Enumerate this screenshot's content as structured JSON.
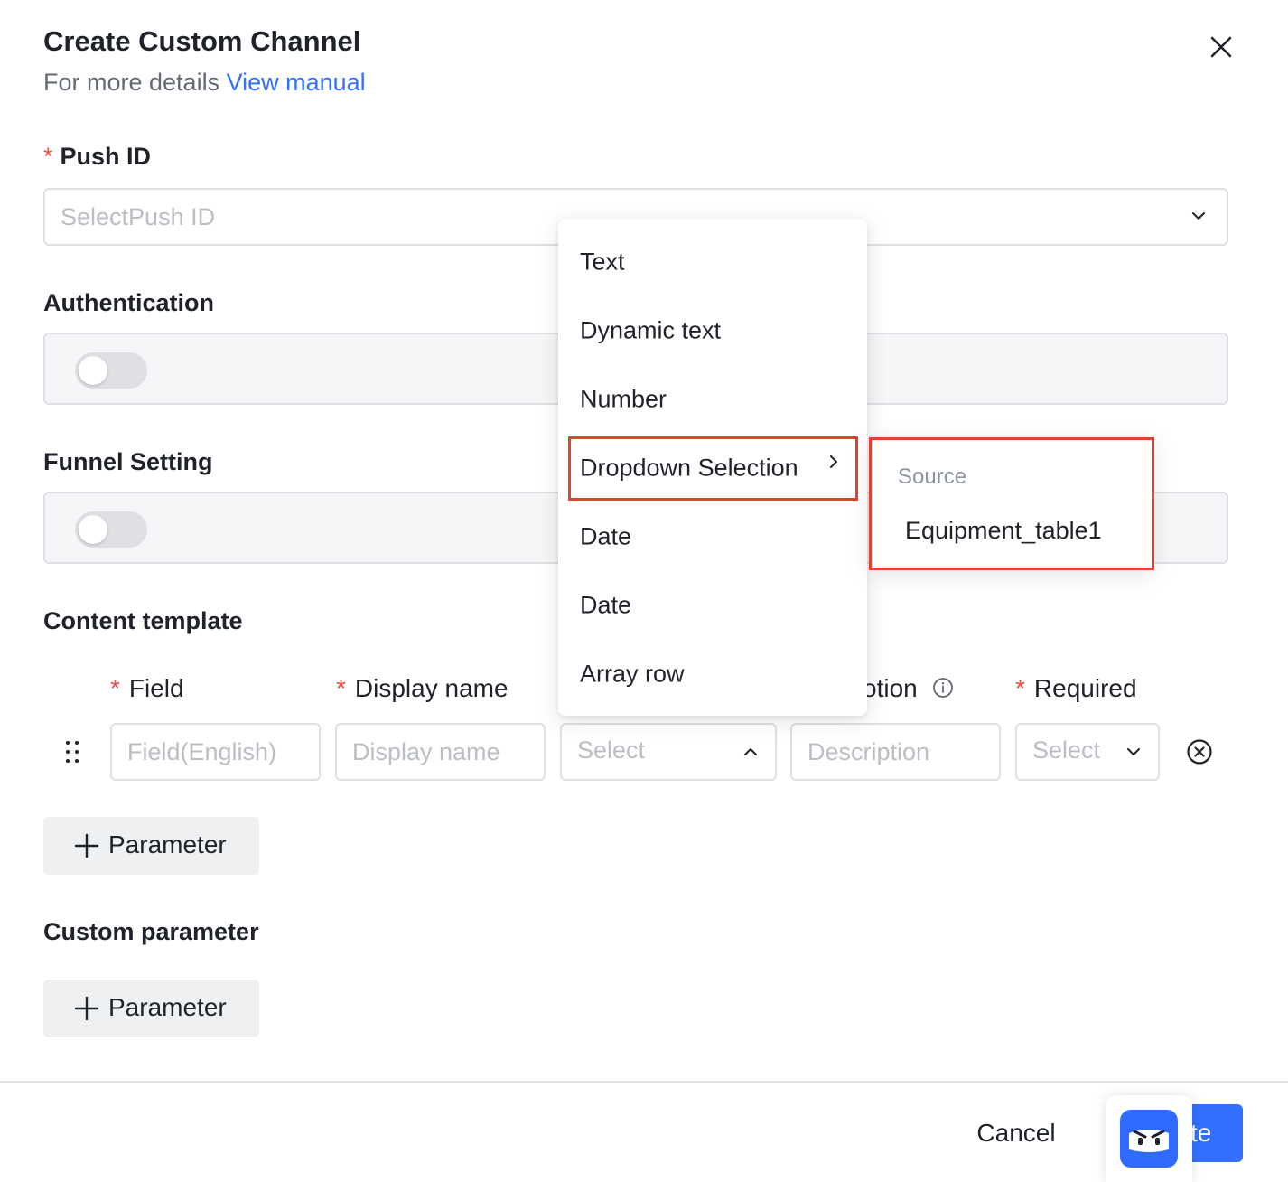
{
  "dialog": {
    "title": "Create Custom Channel",
    "subtitle_prefix": "For more details",
    "manual_link": "View manual"
  },
  "push_id": {
    "required_mark": "*",
    "label": "Push ID",
    "placeholder": "SelectPush ID"
  },
  "authentication": {
    "label": "Authentication",
    "enabled": false
  },
  "funnel": {
    "label": "Funnel Setting",
    "enabled": false
  },
  "content_template": {
    "label": "Content template",
    "columns": {
      "field": "Field",
      "display_name": "Display name",
      "description_partial": "otion",
      "required": "Required"
    },
    "row": {
      "field_placeholder": "Field(English)",
      "display_name_placeholder": "Display name",
      "type_placeholder": "Select",
      "description_placeholder": "Description",
      "required_placeholder": "Select"
    },
    "add_button": "Parameter"
  },
  "custom_parameter": {
    "label": "Custom parameter",
    "add_button": "Parameter"
  },
  "footer": {
    "cancel": "Cancel",
    "confirm_partial": "te"
  },
  "type_menu": {
    "items": [
      "Text",
      "Dynamic text",
      "Number",
      "Dropdown Selection",
      "Date",
      "Date",
      "Array row"
    ],
    "highlighted": "Dropdown Selection"
  },
  "source_submenu": {
    "title": "Source",
    "items": [
      "Equipment_table1"
    ]
  },
  "colors": {
    "primary": "#3370ff",
    "required": "#f54a45",
    "highlight_border": "#e0442e"
  }
}
